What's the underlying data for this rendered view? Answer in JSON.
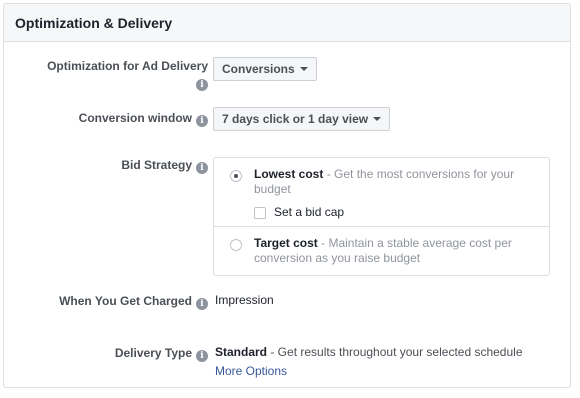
{
  "panel": {
    "title": "Optimization & Delivery"
  },
  "optimization": {
    "label": "Optimization for Ad Delivery",
    "value": "Conversions"
  },
  "conversion_window": {
    "label": "Conversion window",
    "value": "7 days click or 1 day view"
  },
  "bid_strategy": {
    "label": "Bid Strategy",
    "options": [
      {
        "title": "Lowest cost",
        "description": " - Get the most conversions for your budget",
        "selected": true,
        "checkbox_label": "Set a bid cap"
      },
      {
        "title": "Target cost",
        "description": " - Maintain a stable average cost per conversion as you raise budget",
        "selected": false
      }
    ]
  },
  "charged": {
    "label": "When You Get Charged",
    "value": "Impression"
  },
  "delivery_type": {
    "label": "Delivery Type",
    "value": "Standard",
    "description": " - Get results throughout your selected schedule",
    "link": "More Options"
  },
  "icons": {
    "info": "info-icon",
    "caret": "caret-down-icon"
  },
  "colors": {
    "link": "#365899",
    "header_bg": "#f6f7f9",
    "border": "#dddfe2"
  }
}
